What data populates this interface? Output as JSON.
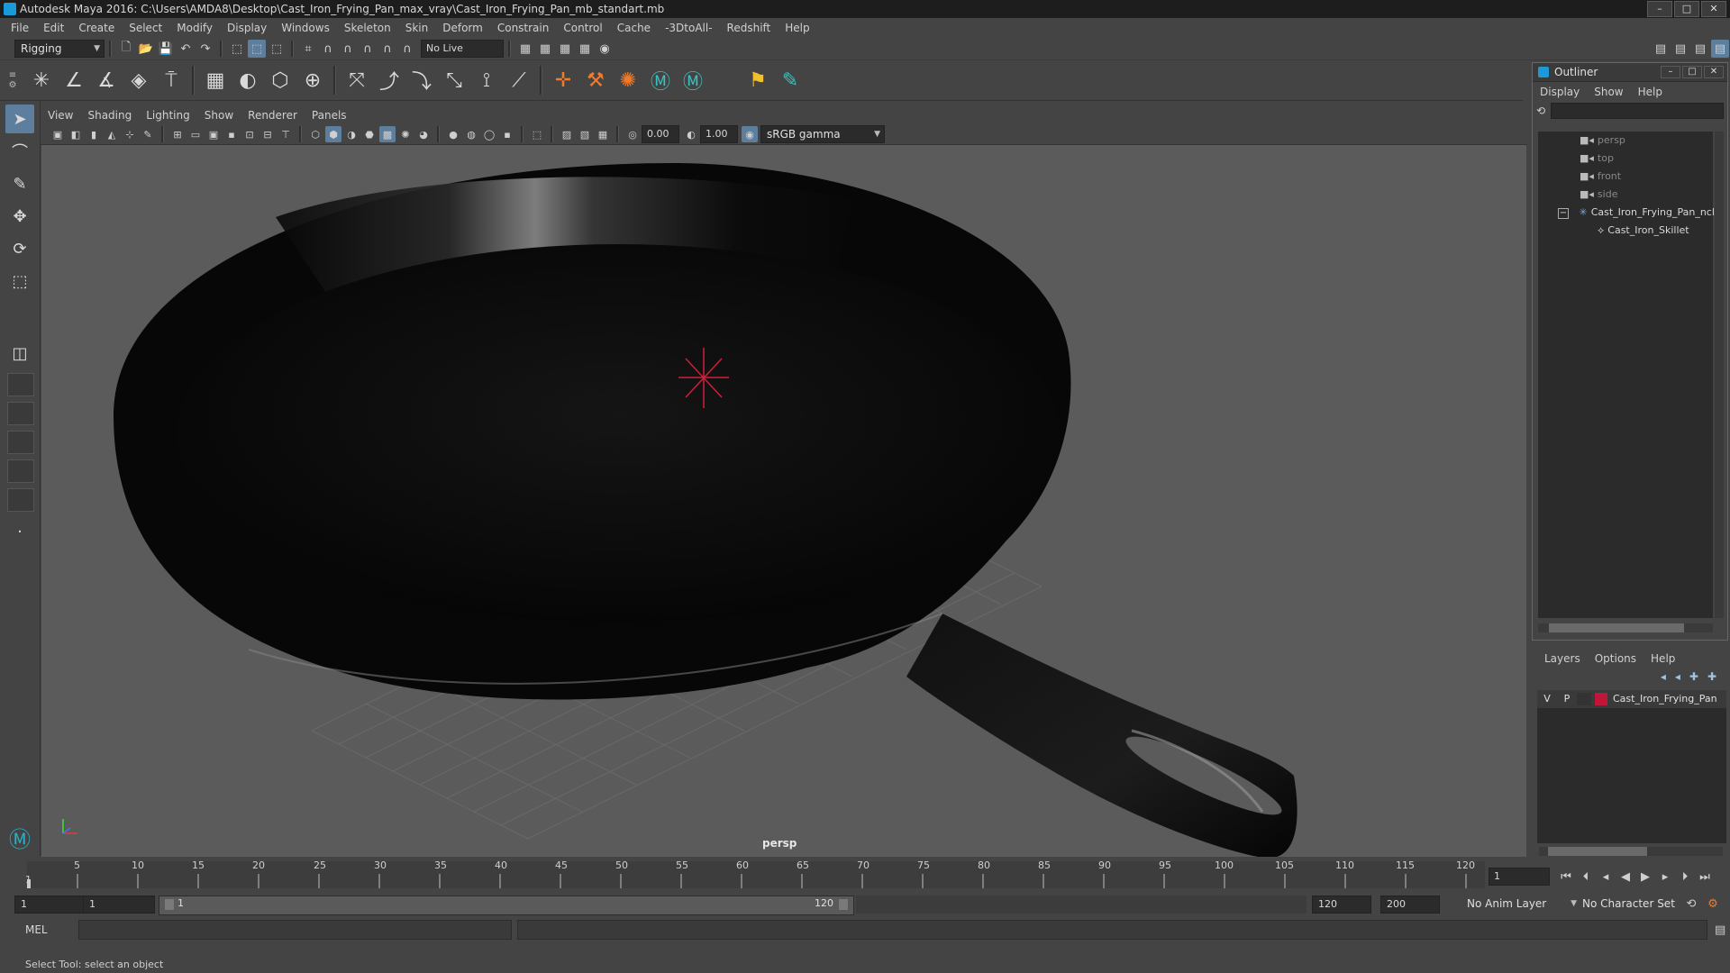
{
  "window": {
    "title": "Autodesk Maya 2016: C:\\Users\\AMDA8\\Desktop\\Cast_Iron_Frying_Pan_max_vray\\Cast_Iron_Frying_Pan_mb_standart.mb",
    "minimize": "–",
    "maximize": "□",
    "close": "✕"
  },
  "menubar": [
    "File",
    "Edit",
    "Create",
    "Select",
    "Modify",
    "Display",
    "Windows",
    "Skeleton",
    "Skin",
    "Deform",
    "Constrain",
    "Control",
    "Cache",
    "-3DtoAll-",
    "Redshift",
    "Help"
  ],
  "statusline": {
    "mode": "Rigging",
    "live_surface": "No Live Surface"
  },
  "panel": {
    "menus": [
      "View",
      "Shading",
      "Lighting",
      "Show",
      "Renderer",
      "Panels"
    ],
    "exposure": "0.00",
    "gamma": "1.00",
    "color_space": "sRGB gamma",
    "camera": "persp"
  },
  "outliner": {
    "title": "Outliner",
    "menus": [
      "Display",
      "Show",
      "Help"
    ],
    "items": [
      {
        "label": "persp",
        "icon": "camera-icon"
      },
      {
        "label": "top",
        "icon": "camera-icon"
      },
      {
        "label": "front",
        "icon": "camera-icon"
      },
      {
        "label": "side",
        "icon": "camera-icon"
      },
      {
        "label": "Cast_Iron_Frying_Pan_ncl",
        "icon": "group-icon"
      },
      {
        "label": "Cast_Iron_Skillet",
        "icon": "mesh-icon"
      }
    ]
  },
  "layers": {
    "menus": [
      "Layers",
      "Options",
      "Help"
    ],
    "row": {
      "v": "V",
      "p": "P",
      "name": "Cast_Iron_Frying_Pan",
      "color": "#c0163a"
    }
  },
  "timeline": {
    "ticks": [
      "5",
      "10",
      "15",
      "20",
      "25",
      "30",
      "35",
      "40",
      "45",
      "50",
      "55",
      "60",
      "65",
      "70",
      "75",
      "80",
      "85",
      "90",
      "95",
      "100",
      "105",
      "110",
      "115",
      "120"
    ],
    "first_tick": "1",
    "current_frame": "1"
  },
  "range": {
    "start": "1",
    "playback_start": "1",
    "slider_start": "1",
    "slider_end": "120",
    "playback_end": "120",
    "end": "200",
    "anim_layer": "No Anim Layer",
    "character_set": "No Character Set"
  },
  "cmd": {
    "lang": "MEL"
  },
  "help": {
    "text": "Select Tool: select an object"
  },
  "colors": {
    "accent": "#5d7f9d",
    "layer_color": "#c0163a",
    "pan": "#0b0b0b"
  }
}
